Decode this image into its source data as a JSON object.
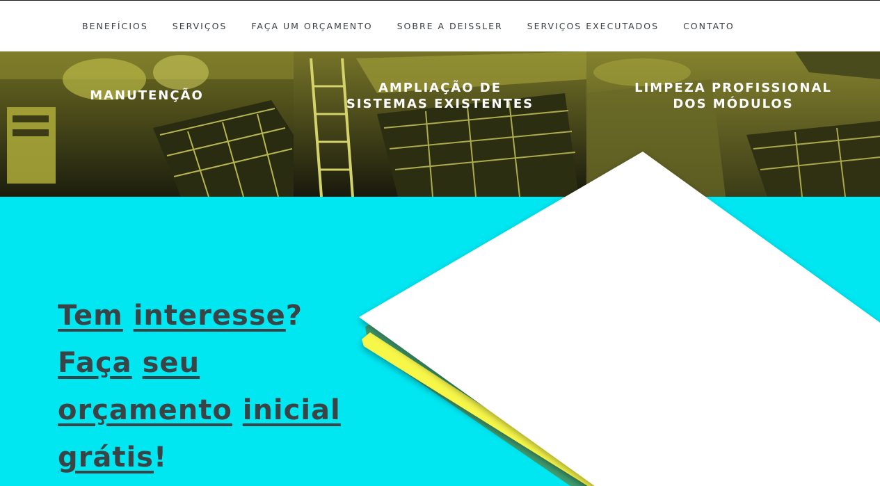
{
  "nav": {
    "items": [
      {
        "label": "BENEFÍCIOS"
      },
      {
        "label": "SERVIÇOS"
      },
      {
        "label": "FAÇA UM ORÇAMENTO"
      },
      {
        "label": "SOBRE A DEISSLER"
      },
      {
        "label": "SERVIÇOS EXECUTADOS"
      },
      {
        "label": "CONTATO"
      }
    ]
  },
  "services": [
    {
      "line1": "MANUTENÇÃO",
      "line2": ""
    },
    {
      "line1": "AMPLIAÇÃO DE",
      "line2": "SISTEMAS EXISTENTES"
    },
    {
      "line1": "LIMPEZA PROFISSIONAL",
      "line2": "DOS MÓDULOS"
    }
  ],
  "lead": {
    "line1_a": "Tem",
    "line1_b": "interesse",
    "line1_c": "?",
    "line2_a": "Faça",
    "line2_b": "seu",
    "line3_a": "orçamento",
    "line3_b": "inicial",
    "line4_a": "grátis",
    "line4_b": "!"
  },
  "colors": {
    "accent_cyan": "#00e7f2",
    "overlay_olive": "#a7a533",
    "highlight_yellow": "#f7f74a",
    "headline_text": "#3a4346"
  }
}
